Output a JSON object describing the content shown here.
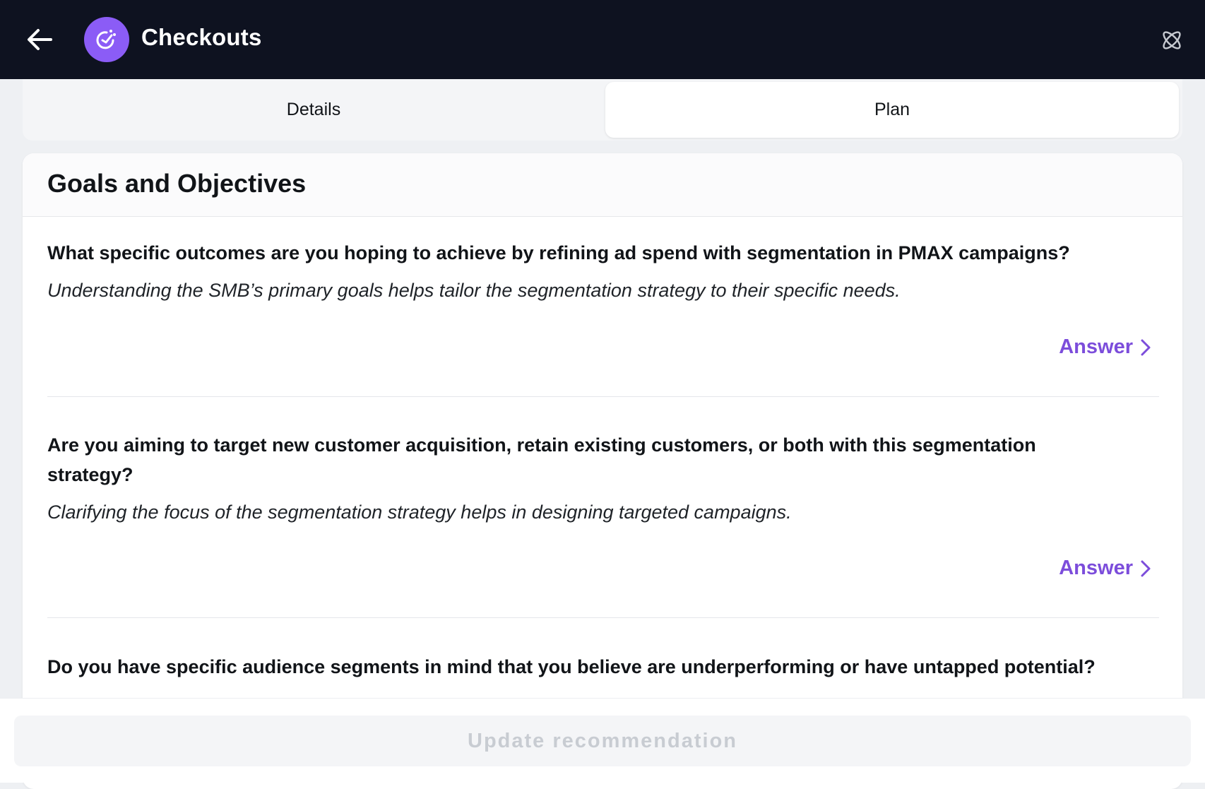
{
  "header": {
    "title": "Checkouts",
    "back_icon": "arrow-left-icon",
    "logo_icon": "checkout-logo-icon",
    "corner_icon": "atom-icon",
    "background": "#0e1220",
    "logo_color": "#8b5cf6"
  },
  "tabs": [
    {
      "label": "Details",
      "active": false
    },
    {
      "label": "Plan",
      "active": true
    }
  ],
  "section": {
    "title": "Goals and Objectives",
    "questions": [
      {
        "question": "What specific outcomes are you hoping to achieve by refining ad spend with segmentation in PMAX campaigns?",
        "hint": "Understanding the SMB’s primary goals helps tailor the segmentation strategy to their specific needs.",
        "action": "Answer"
      },
      {
        "question": "Are you aiming to target new customer acquisition, retain existing customers, or both with this segmentation strategy?",
        "hint": "Clarifying the focus of the segmentation strategy helps in designing targeted campaigns.",
        "action": "Answer"
      },
      {
        "question": "Do you have specific audience segments in mind that you believe are underperforming or have untapped potential?"
      }
    ]
  },
  "footer": {
    "button_label": "Update recommendation",
    "button_disabled": true
  },
  "colors": {
    "accent": "#7c4ddb"
  }
}
